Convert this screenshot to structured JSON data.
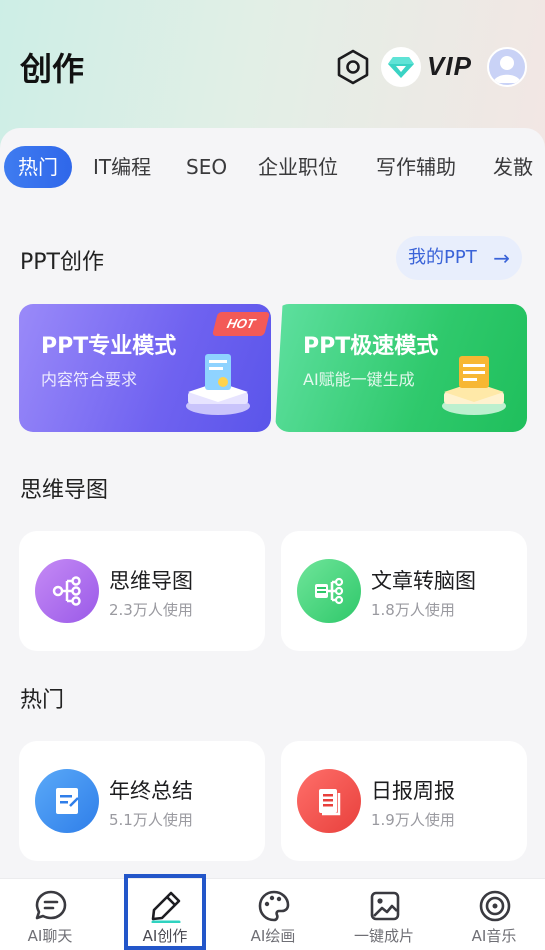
{
  "header": {
    "title": "创作",
    "icons": [
      "settings-hexagon-icon",
      "vip-diamond-icon",
      "avatar-user-icon"
    ],
    "vip_label": "VIP"
  },
  "tabs": [
    {
      "label": "热门",
      "active": true
    },
    {
      "label": "IT编程",
      "active": false
    },
    {
      "label": "SEO",
      "active": false
    },
    {
      "label": "企业职位",
      "active": false
    },
    {
      "label": "写作辅助",
      "active": false
    },
    {
      "label": "发散",
      "active": false
    }
  ],
  "ppt_section": {
    "title": "PPT创作",
    "my_ppt_label": "我的PPT",
    "cards": [
      {
        "title": "PPT专业模式",
        "subtitle": "内容符合要求",
        "tag": "HOT"
      },
      {
        "title": "PPT极速模式",
        "subtitle": "AI赋能一键生成"
      }
    ]
  },
  "mindmap_section": {
    "title": "思维导图",
    "tools": [
      {
        "name": "思维导图",
        "users": "2.3万人使用",
        "icon": "mindmap-icon"
      },
      {
        "name": "文章转脑图",
        "users": "1.8万人使用",
        "icon": "article-to-mindmap-icon"
      }
    ]
  },
  "hot_section": {
    "title": "热门",
    "tools": [
      {
        "name": "年终总结",
        "users": "5.1万人使用",
        "icon": "summary-document-icon"
      },
      {
        "name": "日报周报",
        "users": "1.9万人使用",
        "icon": "report-document-icon"
      }
    ]
  },
  "bottom_nav": [
    {
      "label": "AI聊天",
      "icon": "chat-bubble-icon",
      "active": false
    },
    {
      "label": "AI创作",
      "icon": "pen-icon",
      "active": true
    },
    {
      "label": "AI绘画",
      "icon": "palette-icon",
      "active": false
    },
    {
      "label": "一键成片",
      "icon": "image-icon",
      "active": false
    },
    {
      "label": "AI音乐",
      "icon": "music-disc-icon",
      "active": false
    }
  ],
  "colors": {
    "accent": "#3f7cf0",
    "ppt_pro": "#6f62f0",
    "ppt_fast": "#2fc96c",
    "hot_tag": "#f35a57",
    "nav_highlight": "#2356c9"
  }
}
